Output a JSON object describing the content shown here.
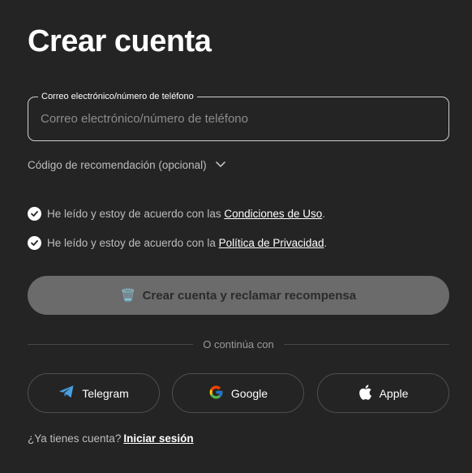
{
  "page": {
    "title": "Crear cuenta"
  },
  "email_field": {
    "label": "Correo electrónico/número de teléfono",
    "placeholder": "Correo electrónico/número de teléfono",
    "value": ""
  },
  "referral": {
    "label": "Código de recomendación (opcional)",
    "icon": "chevron-down-icon"
  },
  "terms": [
    {
      "prefix": "He leído y estoy de acuerdo con las ",
      "link": "Condiciones de Uso",
      "suffix": ".",
      "checked": true
    },
    {
      "prefix": "He leído y estoy de acuerdo con la ",
      "link": "Política de Privacidad",
      "suffix": ".",
      "checked": true
    }
  ],
  "primary_button": {
    "emoji": "🗑️",
    "label": "Crear cuenta y reclamar recompensa"
  },
  "divider": {
    "label": "O continúa con"
  },
  "social": [
    {
      "label": "Telegram",
      "icon": "telegram-icon",
      "color": "#2AABEE"
    },
    {
      "label": "Google",
      "icon": "google-icon"
    },
    {
      "label": "Apple",
      "icon": "apple-icon"
    }
  ],
  "footer": {
    "prompt": "¿Ya tienes cuenta?",
    "link": "Iniciar sesión"
  },
  "colors": {
    "background": "#242424",
    "button_disabled": "#6b6b6b",
    "border": "#4e4e4e"
  }
}
